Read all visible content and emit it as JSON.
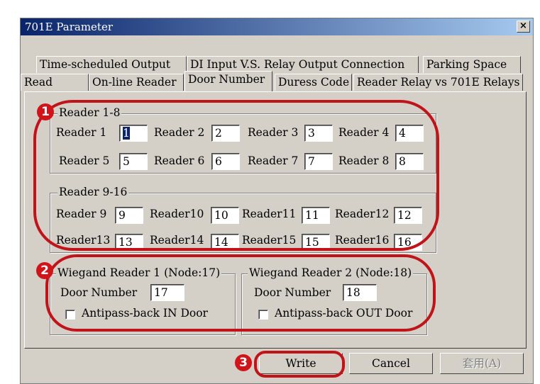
{
  "window": {
    "title": "701E Parameter",
    "close_glyph": "×"
  },
  "tabs": {
    "row1": [
      "Time-scheduled Output",
      "DI Input  V.S. Relay Output Connection",
      "Parking Space"
    ],
    "row2": [
      "Read",
      "On-line Reader",
      "Door Number",
      "Duress Code",
      "Reader Relay vs 701E Relays"
    ],
    "active": "Door Number"
  },
  "group1": {
    "title": "Reader 1-8",
    "readers": [
      {
        "label": "Reader 1",
        "value": "1"
      },
      {
        "label": "Reader 2",
        "value": "2"
      },
      {
        "label": "Reader 3",
        "value": "3"
      },
      {
        "label": "Reader 4",
        "value": "4"
      },
      {
        "label": "Reader 5",
        "value": "5"
      },
      {
        "label": "Reader 6",
        "value": "6"
      },
      {
        "label": "Reader 7",
        "value": "7"
      },
      {
        "label": "Reader 8",
        "value": "8"
      }
    ]
  },
  "group2": {
    "title": "Reader 9-16",
    "readers": [
      {
        "label": "Reader 9",
        "value": "9"
      },
      {
        "label": "Reader10",
        "value": "10"
      },
      {
        "label": "Reader11",
        "value": "11"
      },
      {
        "label": "Reader12",
        "value": "12"
      },
      {
        "label": "Reader13",
        "value": "13"
      },
      {
        "label": "Reader14",
        "value": "14"
      },
      {
        "label": "Reader15",
        "value": "15"
      },
      {
        "label": "Reader16",
        "value": "16"
      }
    ]
  },
  "wiegand1": {
    "title": "Wiegand Reader 1 (Node:17)",
    "door_label": "Door Number",
    "door_value": "17",
    "antipass_label": "Antipass-back  IN  Door",
    "antipass_checked": false
  },
  "wiegand2": {
    "title": "Wiegand Reader 2 (Node:18)",
    "door_label": "Door Number",
    "door_value": "18",
    "antipass_label": "Antipass-back  OUT  Door",
    "antipass_checked": false
  },
  "buttons": {
    "write": "Write",
    "cancel": "Cancel",
    "apply": "套用(A)"
  },
  "markers": [
    "1",
    "2",
    "3"
  ],
  "colors": {
    "annotation": "#c0141a",
    "titlebar": "#0a246a",
    "face": "#d4d0c8"
  }
}
